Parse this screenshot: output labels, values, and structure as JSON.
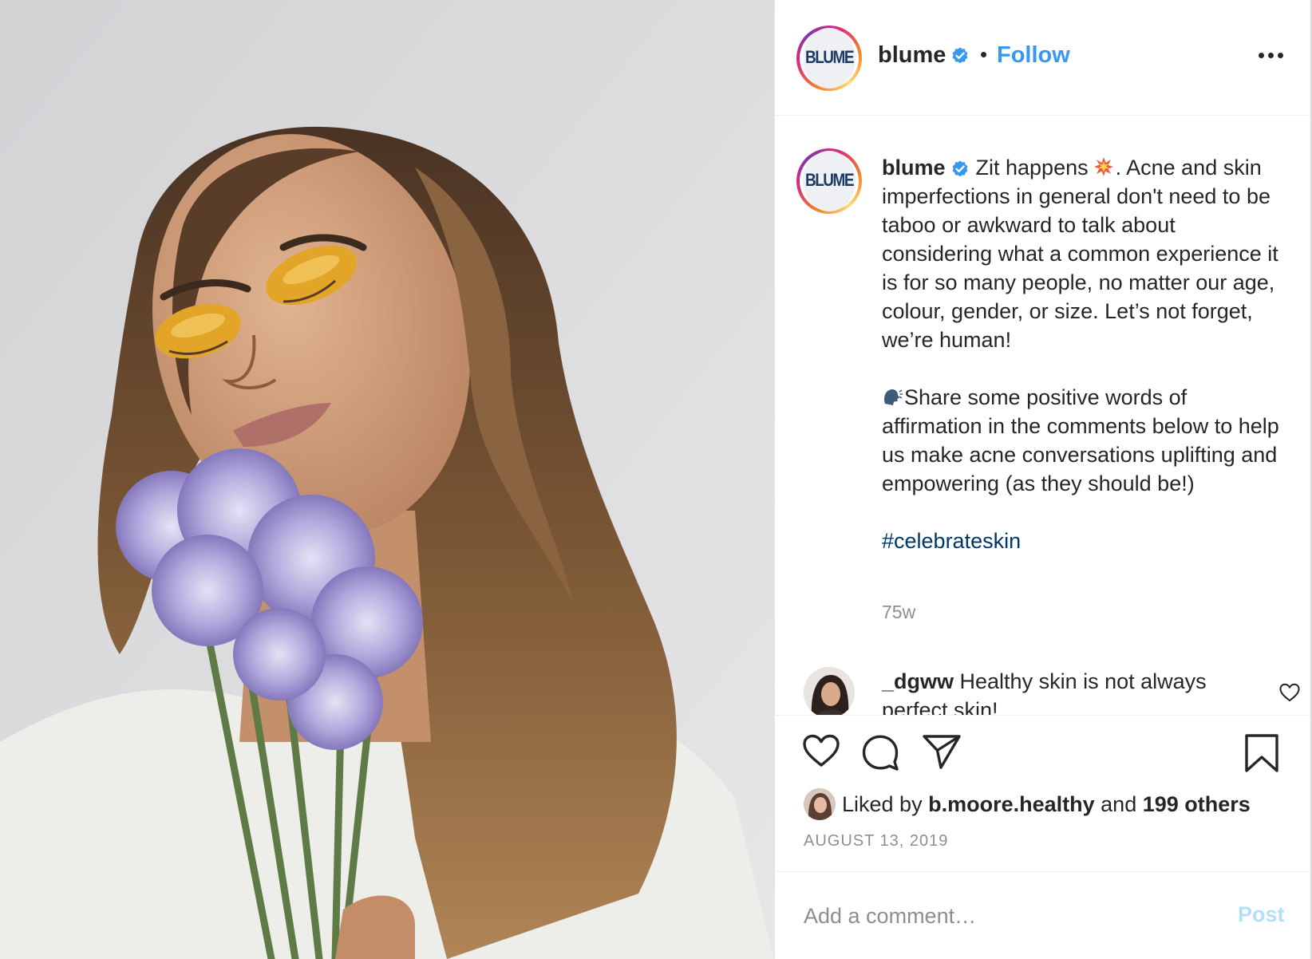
{
  "post": {
    "username": "blume",
    "avatar_text": "BLUME",
    "separator": "•",
    "follow_label": "Follow",
    "caption": {
      "text_1": "Zit happens",
      "text_2": ". Acne and skin imperfections in general don't need to be taboo or awkward to talk about considering what a common experience it is for so many people, no matter our age, colour, gender, or size. Let’s not forget, we’re human!",
      "text_3": "Share some positive words of affirmation in the comments below to help us make acne conversations uplifting and empowering (as they should be!)",
      "hashtag": "#celebrateskin",
      "age": "75w"
    },
    "comments": [
      {
        "username": "_dgww",
        "text": "Healthy skin is not always perfect skin!"
      }
    ],
    "likes": {
      "prefix": "Liked by",
      "first_liker": "b.moore.healthy",
      "joiner": "and",
      "others": "199 others"
    },
    "date": "AUGUST 13, 2019",
    "add_comment": {
      "placeholder": "Add a comment…",
      "post_label": "Post"
    }
  },
  "colors": {
    "accent_blue": "#3897f0",
    "verified_blue": "#3897f0",
    "hashtag": "#00376b",
    "muted": "#8e8e8e",
    "post_disabled": "#b2dffc"
  },
  "icons": [
    "verified-badge-icon",
    "more-options-icon",
    "collision-emoji-icon",
    "speaking-head-emoji-icon",
    "heart-icon",
    "comment-icon",
    "share-icon",
    "bookmark-icon",
    "comment-like-icon"
  ]
}
